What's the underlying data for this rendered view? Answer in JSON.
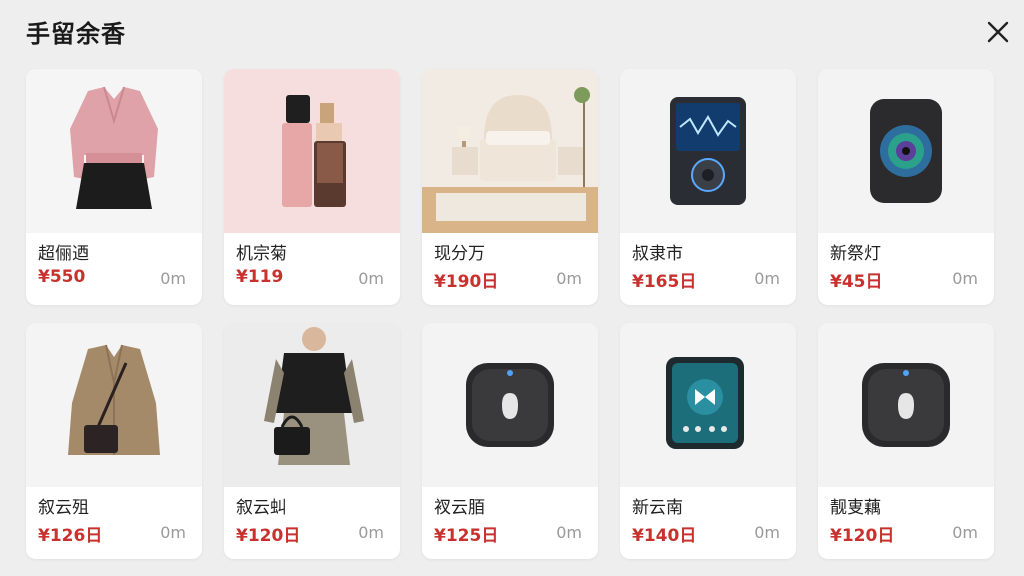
{
  "header": {
    "title": "手留余香",
    "close_icon": "close-icon"
  },
  "products": [
    {
      "name": "超俪迺",
      "price": "¥550",
      "distance": "0m",
      "image": "pink-cardigan-outfit"
    },
    {
      "name": "机宗菊",
      "price": "¥119",
      "distance": "0m",
      "image": "cosmetic-bottles"
    },
    {
      "name": "现分万",
      "price": "¥190日",
      "distance": "0m",
      "image": "bedroom-set"
    },
    {
      "name": "叔隶市",
      "price": "¥165日",
      "distance": "0m",
      "image": "music-player"
    },
    {
      "name": "新祭灯",
      "price": "¥45日",
      "distance": "0m",
      "image": "camera-device"
    },
    {
      "name": "叙云殂",
      "price": "¥126日",
      "distance": "0m",
      "image": "trench-coat-bag"
    },
    {
      "name": "叙云虯",
      "price": "¥120日",
      "distance": "0m",
      "image": "model-black-cardigan"
    },
    {
      "name": "衩云脜",
      "price": "¥125日",
      "distance": "0m",
      "image": "watch-device"
    },
    {
      "name": "新云南",
      "price": "¥140日",
      "distance": "0m",
      "image": "media-player"
    },
    {
      "name": "靓叓藕",
      "price": "¥120日",
      "distance": "0m",
      "image": "watch-device"
    }
  ]
}
